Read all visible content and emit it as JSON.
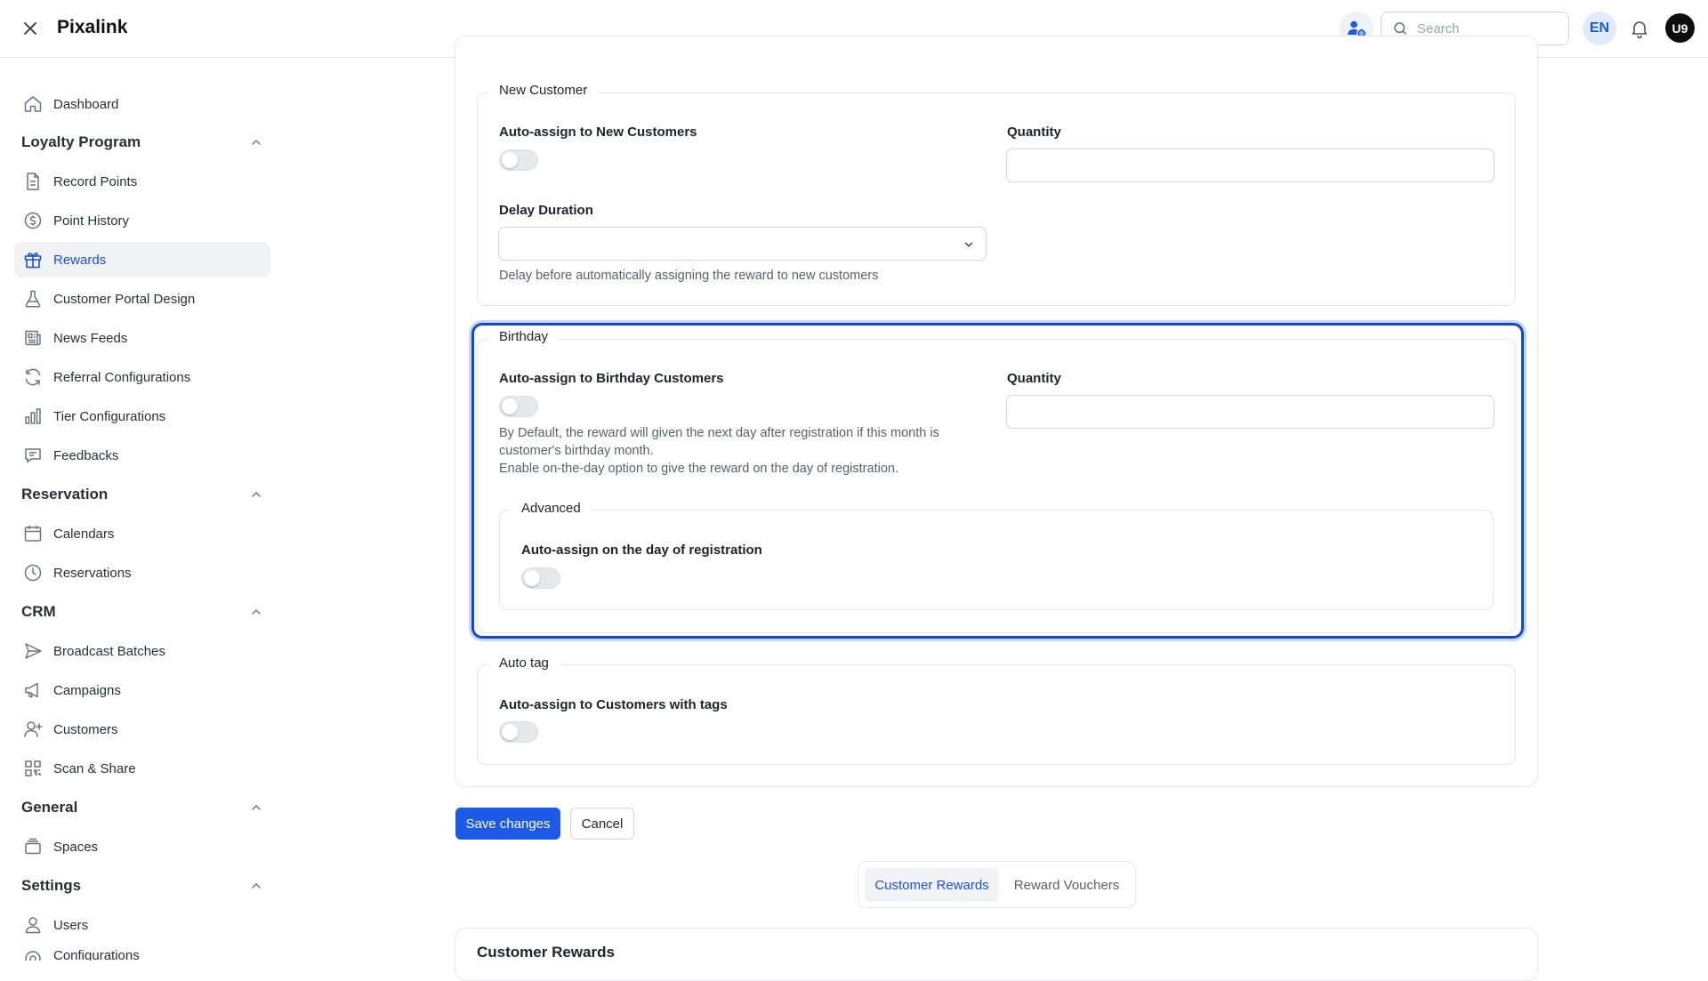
{
  "header": {
    "app_name": "Pixalink",
    "search_placeholder": "Search",
    "language": "EN",
    "user_initials": "U9"
  },
  "sidebar": {
    "dashboard": "Dashboard",
    "groups": {
      "loyalty": "Loyalty Program",
      "reservation": "Reservation",
      "crm": "CRM",
      "general": "General",
      "settings": "Settings"
    },
    "items": {
      "record_points": "Record Points",
      "point_history": "Point History",
      "rewards": "Rewards",
      "portal_design": "Customer Portal Design",
      "news_feeds": "News Feeds",
      "referral": "Referral Configurations",
      "tier": "Tier Configurations",
      "feedbacks": "Feedbacks",
      "calendars": "Calendars",
      "reservations": "Reservations",
      "broadcast": "Broadcast Batches",
      "campaigns": "Campaigns",
      "customers": "Customers",
      "scan_share": "Scan & Share",
      "spaces": "Spaces",
      "users": "Users",
      "configurations": "Configurations"
    },
    "active_item": "Rewards"
  },
  "new_customer": {
    "legend": "New Customer",
    "auto_assign_label": "Auto-assign to New Customers",
    "auto_assign_enabled": false,
    "quantity_label": "Quantity",
    "quantity_value": "",
    "delay_label": "Delay Duration",
    "delay_value": "",
    "delay_help": "Delay before automatically assigning the reward to new customers"
  },
  "birthday": {
    "legend": "Birthday",
    "auto_assign_label": "Auto-assign to Birthday Customers",
    "auto_assign_enabled": false,
    "quantity_label": "Quantity",
    "quantity_value": "",
    "help_line1": "By Default, the reward will given the next day after registration if this month is",
    "help_line2": "customer's birthday month.",
    "help_line3": "Enable on-the-day option to give the reward on the day of registration.",
    "advanced": {
      "legend": "Advanced",
      "day_of_registration_label": "Auto-assign on the day of registration",
      "day_of_registration_enabled": false
    }
  },
  "auto_tag": {
    "legend": "Auto tag",
    "label": "Auto-assign to Customers with tags",
    "enabled": false
  },
  "actions": {
    "save": "Save changes",
    "cancel": "Cancel"
  },
  "tabs": {
    "customer_rewards": "Customer Rewards",
    "reward_vouchers": "Reward Vouchers",
    "active": "Customer Rewards"
  },
  "bottom_section": {
    "title": "Customer Rewards"
  },
  "colors": {
    "accent": "#1d5ae8",
    "active_nav_text": "#1d4fd7",
    "focus_border": "#1747c9"
  }
}
